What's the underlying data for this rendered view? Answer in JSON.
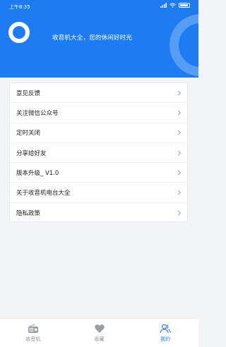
{
  "status_bar": {
    "time": "上午8:35"
  },
  "header": {
    "slogan": "收音机大全，您的休闲好时光",
    "brand_color": "#1e7cf2"
  },
  "menu": {
    "items": [
      {
        "label": "意见反馈"
      },
      {
        "label": "关注微信公众号"
      },
      {
        "label": "定时关闭"
      },
      {
        "label": "分享给好友"
      },
      {
        "label": "版本升级_ V1.0"
      },
      {
        "label": "关于收音机电台大全"
      },
      {
        "label": "隐私政策"
      }
    ]
  },
  "tabbar": {
    "tabs": [
      {
        "label": "收音机",
        "icon": "radio-icon",
        "active": false
      },
      {
        "label": "收藏",
        "icon": "heart-icon",
        "active": false
      },
      {
        "label": "我的",
        "icon": "user-icon",
        "active": true
      }
    ],
    "active_color": "#2a7de1"
  }
}
